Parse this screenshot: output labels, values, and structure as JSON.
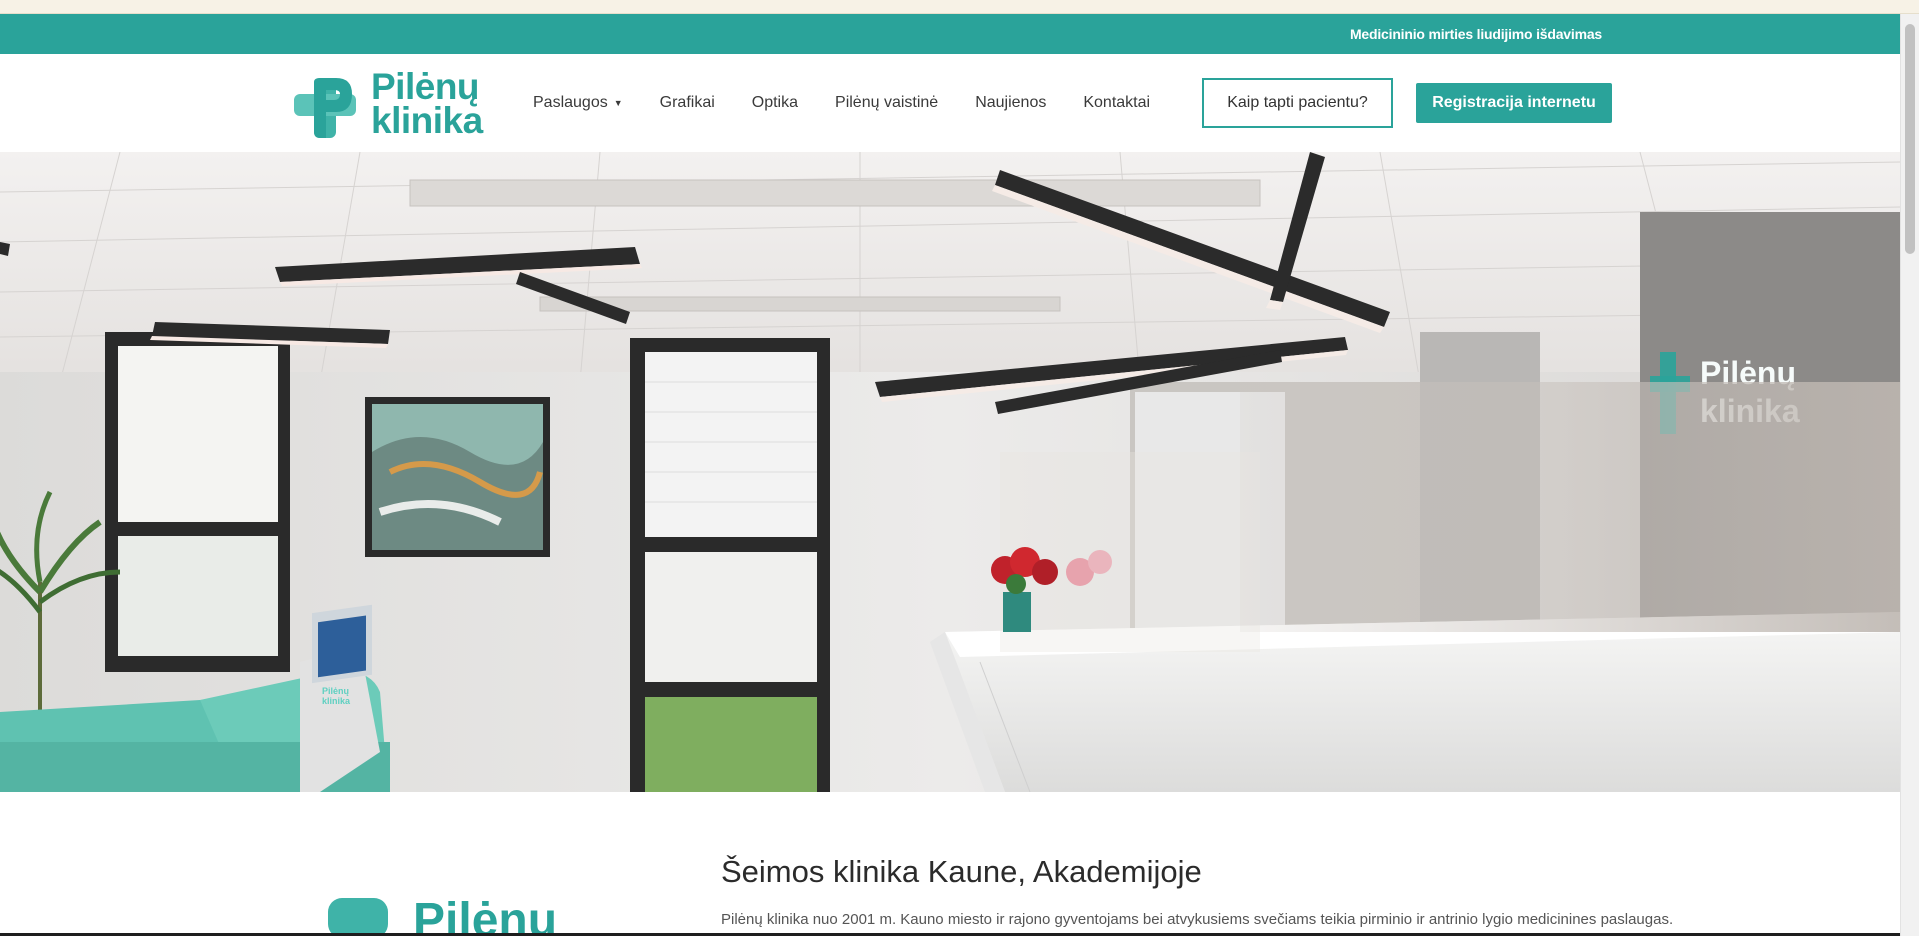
{
  "topbar": {
    "link": "Medicininio mirties liudijimo išdavimas"
  },
  "logo": {
    "line1": "Pilėnų",
    "line2": "klinika"
  },
  "nav": {
    "items": [
      {
        "label": "Paslaugos",
        "has_dropdown": true
      },
      {
        "label": "Grafikai"
      },
      {
        "label": "Optika"
      },
      {
        "label": "Pilėnų vaistinė"
      },
      {
        "label": "Naujienos"
      },
      {
        "label": "Kontaktai"
      }
    ],
    "cta_outline": "Kaip tapti pacientu?",
    "cta_solid": "Registracija internetu"
  },
  "hero": {
    "sign_line1": "Pilėnų",
    "sign_line2": "klinika",
    "kiosk_line1": "Pilėnų",
    "kiosk_line2": "klinika"
  },
  "intro": {
    "title": "Šeimos klinika Kaune, Akademijoje",
    "text": "Pilėnų klinika nuo 2001 m. Kauno miesto ir rajono gyventojams bei atvykusiems svečiams teikia pirminio ir antrinio lygio medicinines paslaugas.",
    "logo_word": "Pilėnų"
  },
  "colors": {
    "brand": "#2aa39a",
    "topbar": "#2aa39a",
    "text": "#333333"
  }
}
